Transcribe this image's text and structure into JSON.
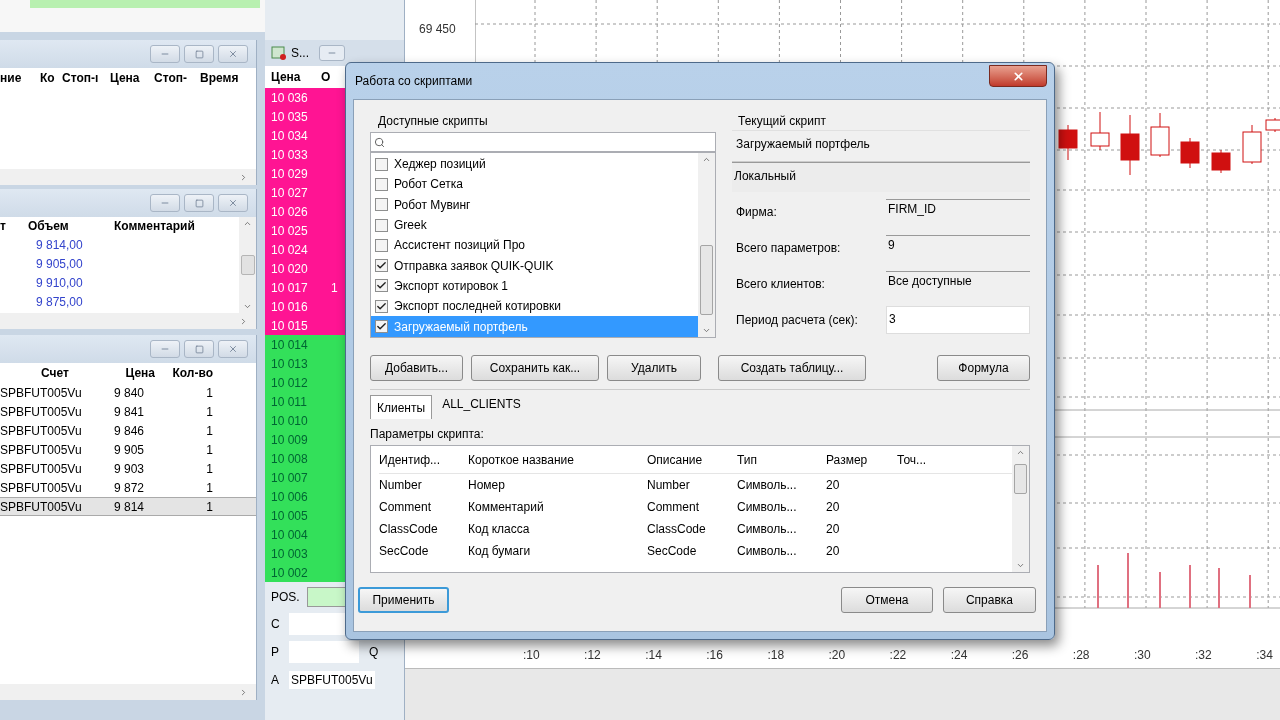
{
  "orders_panel": {
    "columns": [
      "ние",
      "Ко",
      "Стоп-ı",
      "Цена",
      "Стоп-",
      "Время"
    ]
  },
  "deals_panel": {
    "columns": [
      "т",
      "Объем",
      "Комментарий"
    ],
    "rows": [
      {
        "volume": "9 814,00"
      },
      {
        "volume": "9 905,00"
      },
      {
        "volume": "9 910,00"
      },
      {
        "volume": "9 875,00"
      }
    ]
  },
  "trades_panel": {
    "columns": [
      "Счет",
      "Цена",
      "Кол-во"
    ],
    "rows": [
      {
        "account": "SPBFUT005Vu",
        "price": "9 840",
        "qty": "1",
        "selected": false
      },
      {
        "account": "SPBFUT005Vu",
        "price": "9 841",
        "qty": "1",
        "selected": false
      },
      {
        "account": "SPBFUT005Vu",
        "price": "9 846",
        "qty": "1",
        "selected": false
      },
      {
        "account": "SPBFUT005Vu",
        "price": "9 905",
        "qty": "1",
        "selected": false
      },
      {
        "account": "SPBFUT005Vu",
        "price": "9 903",
        "qty": "1",
        "selected": false
      },
      {
        "account": "SPBFUT005Vu",
        "price": "9 872",
        "qty": "1",
        "selected": false
      },
      {
        "account": "SPBFUT005Vu",
        "price": "9 814",
        "qty": "1",
        "selected": true
      }
    ]
  },
  "order_book": {
    "title": "S...",
    "columns": [
      "Цена",
      "О"
    ],
    "rows": [
      {
        "price": "10 036",
        "kind": "sell"
      },
      {
        "price": "10 035",
        "kind": "sell"
      },
      {
        "price": "10 034",
        "kind": "sell"
      },
      {
        "price": "10 033",
        "kind": "sell"
      },
      {
        "price": "10 029",
        "kind": "sell"
      },
      {
        "price": "10 027",
        "kind": "sell"
      },
      {
        "price": "10 026",
        "kind": "sell"
      },
      {
        "price": "10 025",
        "kind": "sell"
      },
      {
        "price": "10 024",
        "kind": "sell"
      },
      {
        "price": "10 020",
        "kind": "sell"
      },
      {
        "price": "10 017",
        "kind": "sell",
        "qty": "1"
      },
      {
        "price": "10 016",
        "kind": "sell"
      },
      {
        "price": "10 015",
        "kind": "sell"
      },
      {
        "price": "10 014",
        "kind": "buy"
      },
      {
        "price": "10 013",
        "kind": "buy"
      },
      {
        "price": "10 012",
        "kind": "buy"
      },
      {
        "price": "10 011",
        "kind": "buy"
      },
      {
        "price": "10 010",
        "kind": "buy"
      },
      {
        "price": "10 009",
        "kind": "buy"
      },
      {
        "price": "10 008",
        "kind": "buy"
      },
      {
        "price": "10 007",
        "kind": "buy"
      },
      {
        "price": "10 006",
        "kind": "buy"
      },
      {
        "price": "10 005",
        "kind": "buy"
      },
      {
        "price": "10 004",
        "kind": "buy"
      },
      {
        "price": "10 003",
        "kind": "buy"
      },
      {
        "price": "10 002",
        "kind": "buy"
      }
    ]
  },
  "order_form": {
    "pos_label": "POS.",
    "c_label": "C",
    "p_label": "P",
    "q_label": "Q",
    "a_label": "A",
    "account": "SPBFUT005Vu"
  },
  "chart": {
    "y_label": "69 450",
    "x_labels": [
      ":10",
      ":12",
      ":14",
      ":16",
      ":18",
      ":20",
      ":22",
      ":24",
      ":26",
      ":28",
      ":30",
      ":32",
      ":34"
    ]
  },
  "dialog": {
    "title": "Работа со скриптами",
    "available_label": "Доступные скрипты",
    "scripts": [
      {
        "name": "Хеджер позиций",
        "checked": false,
        "selected": false
      },
      {
        "name": "Робот Сетка",
        "checked": false,
        "selected": false
      },
      {
        "name": "Робот Мувинг",
        "checked": false,
        "selected": false
      },
      {
        "name": "Greek",
        "checked": false,
        "selected": false
      },
      {
        "name": "Ассистент позиций Про",
        "checked": false,
        "selected": false
      },
      {
        "name": "Отправка заявок QUIK-QUIK",
        "checked": true,
        "selected": false
      },
      {
        "name": "Экспорт котировок 1",
        "checked": true,
        "selected": false
      },
      {
        "name": "Экспорт последней котировки",
        "checked": true,
        "selected": false
      },
      {
        "name": "Загружаемый портфель",
        "checked": true,
        "selected": true
      }
    ],
    "current_label": "Текущий скрипт",
    "current_name": "Загружаемый портфель",
    "location": "Локальный",
    "fields": [
      {
        "label": "Фирма:",
        "value": "FIRM_ID",
        "kind": "readonly"
      },
      {
        "label": "Всего параметров:",
        "value": "9",
        "kind": "readonly"
      },
      {
        "label": "Всего клиентов:",
        "value": "Все доступные",
        "kind": "readonly"
      },
      {
        "label": "Период расчета (сек):",
        "value": "3",
        "kind": "input"
      }
    ],
    "buttons": [
      "Добавить...",
      "Сохранить как...",
      "Удалить",
      "Создать таблицу..."
    ],
    "formula_button": "Формула",
    "tab": {
      "label": "Клиенты",
      "selected": true
    },
    "clients": "ALL_CLIENTS",
    "params_label": "Параметры скрипта:",
    "params_columns": [
      "Идентиф...",
      "Короткое название",
      "Описание",
      "Тип",
      "Размер",
      "Точ..."
    ],
    "params_rows": [
      [
        "Number",
        "Номер",
        "Number",
        "Символь...",
        "20"
      ],
      [
        "Comment",
        "Комментарий",
        "Comment",
        "Символь...",
        "20"
      ],
      [
        "ClassCode",
        "Код класса",
        "ClassCode",
        "Символь...",
        "20"
      ],
      [
        "SecCode",
        "Код бумаги",
        "SecCode",
        "Символь...",
        "20"
      ]
    ],
    "apply_button": "Применить",
    "cancel_button": "Отмена",
    "help_button": "Справка"
  }
}
